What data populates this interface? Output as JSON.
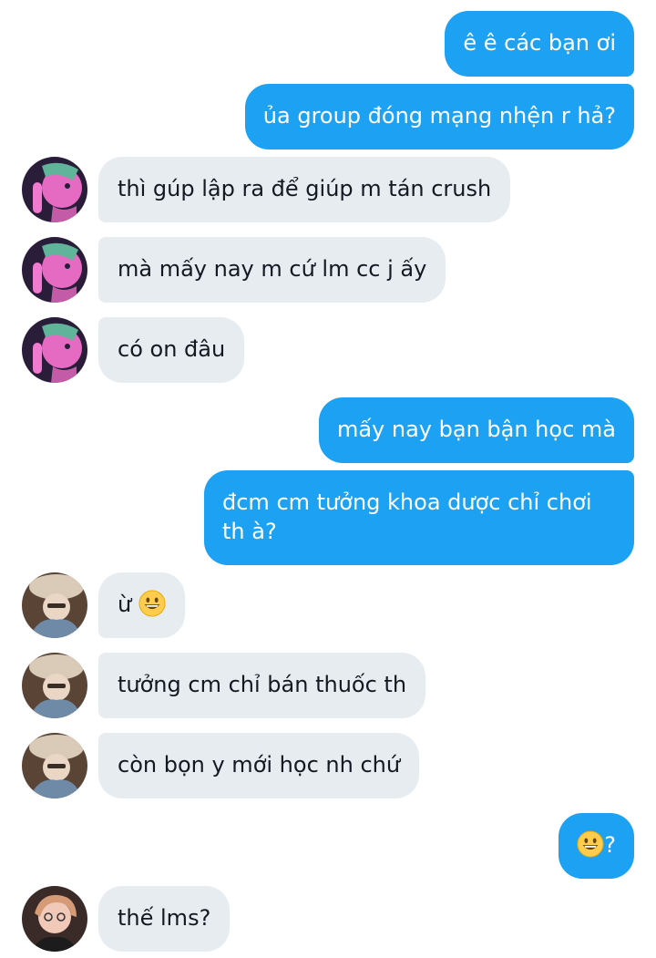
{
  "messages": [
    {
      "side": "out",
      "text": "ê ê các bạn ơi"
    },
    {
      "side": "out",
      "text": "ủa group đóng mạng nhện r hả?"
    },
    {
      "side": "in",
      "sender": "user-a",
      "text": "thì gúp lập ra để giúp m tán crush"
    },
    {
      "side": "in",
      "sender": "user-a",
      "text": "mà mấy nay m cứ lm cc j ấy"
    },
    {
      "side": "in",
      "sender": "user-a",
      "text": "có on đâu"
    },
    {
      "side": "out",
      "text": "mấy nay bạn bận học mà"
    },
    {
      "side": "out",
      "text": "đcm cm tưởng khoa dược chỉ chơi th à?"
    },
    {
      "side": "in",
      "sender": "user-b",
      "text": "ừ",
      "emoji": "grinning-face"
    },
    {
      "side": "in",
      "sender": "user-b",
      "text": "tưởng cm chỉ bán thuốc th"
    },
    {
      "side": "in",
      "sender": "user-b",
      "text": "còn bọn y mới học nh chứ"
    },
    {
      "side": "out",
      "text": "?",
      "emoji": "grinning-face"
    },
    {
      "side": "in",
      "sender": "user-c",
      "text": "thế lms?"
    }
  ],
  "colors": {
    "outgoing_bubble": "#1DA1F2",
    "incoming_bubble": "#E7ECF0",
    "incoming_text": "#141823",
    "outgoing_text": "#FFFFFF"
  }
}
